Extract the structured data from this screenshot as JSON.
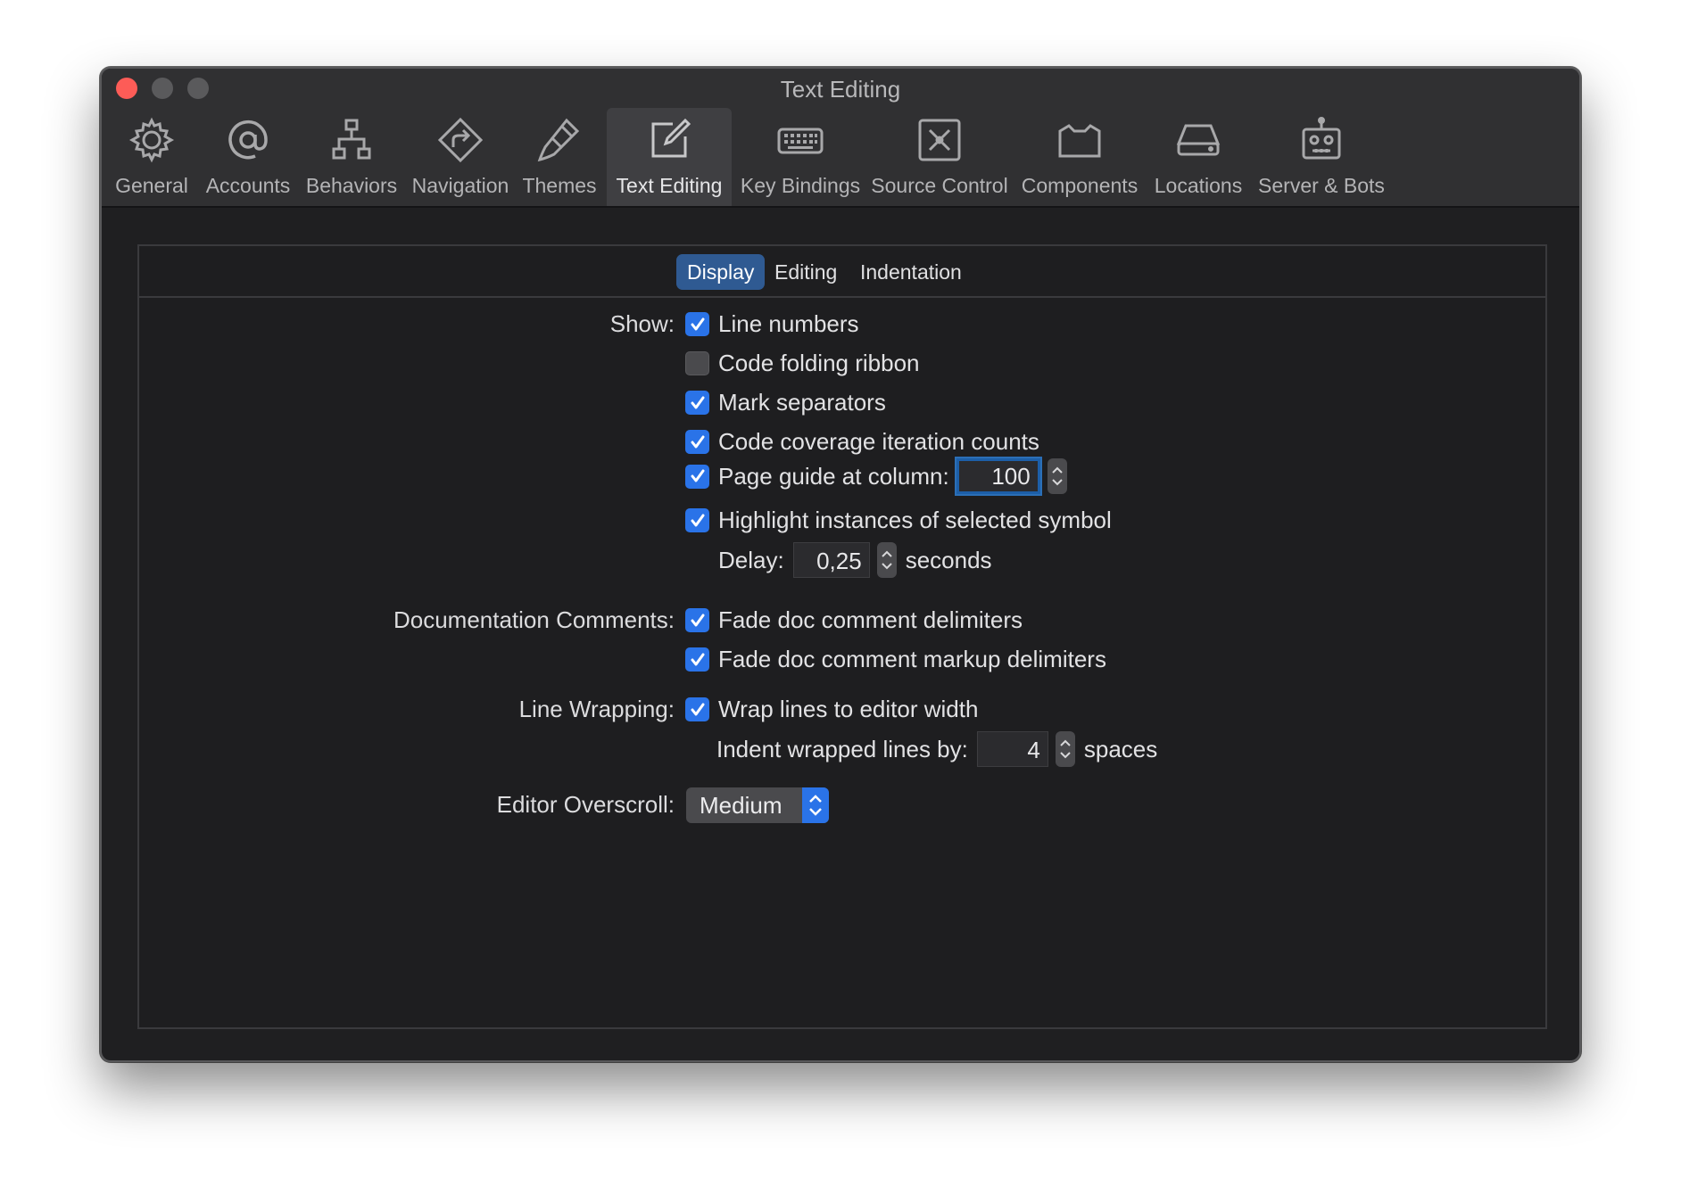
{
  "window": {
    "title": "Text Editing"
  },
  "toolbar": {
    "items": [
      {
        "label": "General",
        "icon": "gear-icon"
      },
      {
        "label": "Accounts",
        "icon": "at-sign-icon"
      },
      {
        "label": "Behaviors",
        "icon": "hierarchy-icon"
      },
      {
        "label": "Navigation",
        "icon": "navigation-diamond-icon"
      },
      {
        "label": "Themes",
        "icon": "paintbrush-icon"
      },
      {
        "label": "Text Editing",
        "icon": "edit-pencil-icon",
        "active": true
      },
      {
        "label": "Key Bindings",
        "icon": "keyboard-icon"
      },
      {
        "label": "Source Control",
        "icon": "source-control-icon"
      },
      {
        "label": "Components",
        "icon": "components-box-icon"
      },
      {
        "label": "Locations",
        "icon": "drive-icon"
      },
      {
        "label": "Server & Bots",
        "icon": "robot-icon"
      }
    ]
  },
  "tabs": [
    "Display",
    "Editing",
    "Indentation"
  ],
  "active_tab": "Display",
  "show": {
    "label": "Show:",
    "line_numbers": {
      "label": "Line numbers",
      "checked": true
    },
    "code_folding": {
      "label": "Code folding ribbon",
      "checked": false
    },
    "mark_separators": {
      "label": "Mark separators",
      "checked": true
    },
    "code_coverage": {
      "label": "Code coverage iteration counts",
      "checked": true
    },
    "page_guide": {
      "label": "Page guide at column:",
      "checked": true,
      "value": "100"
    },
    "highlight": {
      "label": "Highlight instances of selected symbol",
      "checked": true
    },
    "delay": {
      "label": "Delay:",
      "value": "0,25",
      "unit": "seconds"
    }
  },
  "doc_comments": {
    "label": "Documentation Comments:",
    "fade_delims": {
      "label": "Fade doc comment delimiters",
      "checked": true
    },
    "fade_markup": {
      "label": "Fade doc comment markup delimiters",
      "checked": true
    }
  },
  "line_wrapping": {
    "label": "Line Wrapping:",
    "wrap": {
      "label": "Wrap lines to editor width",
      "checked": true
    },
    "indent": {
      "label": "Indent wrapped lines by:",
      "value": "4",
      "unit": "spaces"
    }
  },
  "overscroll": {
    "label": "Editor Overscroll:",
    "value": "Medium"
  },
  "colors": {
    "accent": "#2a73e8",
    "close": "#fd5c57",
    "background": "#1f1f21"
  }
}
